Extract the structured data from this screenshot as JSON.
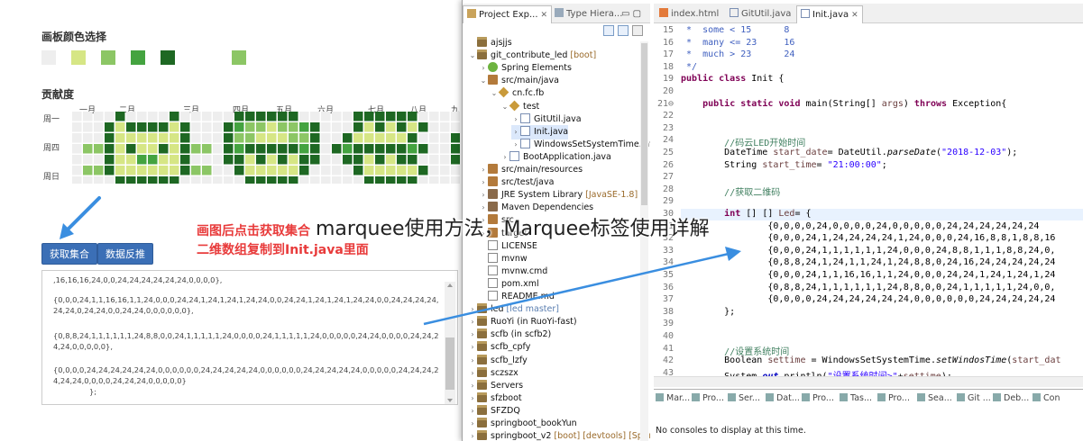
{
  "web": {
    "palette_title": "画板颜色选择",
    "contrib_title": "贡献度",
    "palette_colors": [
      "#eeeeee",
      "#d6e685",
      "#8cc665",
      "#44a340",
      "#1e6823",
      "#8cc665"
    ],
    "heat_colors": {
      "0": "#eeeeee",
      "1": "#d6e685",
      "8": "#8cc665",
      "16": "#44a340",
      "24": "#1e6823"
    },
    "months": [
      "一月",
      "二月",
      "三月",
      "四月",
      "五月",
      "六月",
      "七月",
      "八月",
      "九"
    ],
    "weekdays": [
      "周一",
      "周四",
      "周日"
    ],
    "buttons": {
      "fetch": "获取集合",
      "reverse": "数据反推"
    },
    "annotation_line1": "画图后点击获取集合",
    "annotation_line2": "二维数组复制到Init.java里面",
    "textarea_lines": [
      ",16,16,16,24,0,0,24,24,24,24,24,24,0,0,0,0},",
      "{0,0,0,24,1,1,16,16,1,1,24,0,0,0,24,24,1,24,1,24,1,24,24,0,0,24,24,1,24,1,24,1,24,24,0,0,24,24,24,24,24,24,0,24,24,0,0,24,24,0,0,0,0,0,0},",
      "{0,8,8,24,1,1,1,1,1,1,24,8,8,0,0,24,1,1,1,1,1,24,0,0,0,0,24,1,1,1,1,1,24,0,0,0,0,0,24,24,0,0,0,0,24,24,24,24,0,0,0,0,0},",
      "{0,0,0,0,24,24,24,24,24,24,0,0,0,0,0,0,24,24,24,24,24,0,0,0,0,0,0,24,24,24,24,24,0,0,0,0,0,24,24,24,24,24,24,0,0,0,0,24,24,24,0,0,0,0,0}",
      "};"
    ]
  },
  "eclipse": {
    "tree_tabs": {
      "explorer": "Project Exp...",
      "hierarchy": "Type Hiera..."
    },
    "editor_tabs": [
      "index.html",
      "GitUtil.java",
      "Init.java"
    ],
    "tree": [
      {
        "label": "ajsjjs",
        "depth": 0,
        "icon": "proj",
        "tw": ""
      },
      {
        "label": "git_contribute_led",
        "ann": "[boot]",
        "depth": 0,
        "icon": "proj",
        "tw": "v"
      },
      {
        "label": "Spring Elements",
        "depth": 1,
        "icon": "spring",
        "tw": ">"
      },
      {
        "label": "src/main/java",
        "depth": 1,
        "icon": "src",
        "tw": "v"
      },
      {
        "label": "cn.fc.fb",
        "depth": 2,
        "icon": "pkg",
        "tw": "v"
      },
      {
        "label": "test",
        "depth": 3,
        "icon": "pkg",
        "tw": "v"
      },
      {
        "label": "GitUtil.java",
        "depth": 4,
        "icon": "java",
        "tw": ">"
      },
      {
        "label": "Init.java",
        "depth": 4,
        "icon": "java",
        "tw": ">",
        "selected": true
      },
      {
        "label": "WindowsSetSystemTime.java",
        "depth": 4,
        "icon": "java",
        "tw": ">"
      },
      {
        "label": "BootApplication.java",
        "depth": 3,
        "icon": "java",
        "tw": ">"
      },
      {
        "label": "src/main/resources",
        "depth": 1,
        "icon": "src",
        "tw": ">"
      },
      {
        "label": "src/test/java",
        "depth": 1,
        "icon": "src",
        "tw": ">"
      },
      {
        "label": "JRE System Library",
        "ann": "[JavaSE-1.8]",
        "depth": 1,
        "icon": "lib",
        "tw": ">"
      },
      {
        "label": "Maven Dependencies",
        "depth": 1,
        "icon": "lib",
        "tw": ">"
      },
      {
        "label": "src",
        "depth": 1,
        "icon": "src",
        "tw": ">"
      },
      {
        "label": "target",
        "depth": 1,
        "icon": "src",
        "tw": ">"
      },
      {
        "label": "LICENSE",
        "depth": 1,
        "icon": "file",
        "tw": ""
      },
      {
        "label": "mvnw",
        "depth": 1,
        "icon": "file",
        "tw": ""
      },
      {
        "label": "mvnw.cmd",
        "depth": 1,
        "icon": "file",
        "tw": ""
      },
      {
        "label": "pom.xml",
        "depth": 1,
        "icon": "file",
        "tw": ""
      },
      {
        "label": "README.md",
        "depth": 1,
        "icon": "file",
        "tw": ""
      },
      {
        "label": "led",
        "ann": "[led master]",
        "depth": 0,
        "icon": "proj",
        "tw": ">",
        "annBlue": true
      },
      {
        "label": "RuoYi (in RuoYi-fast)",
        "depth": 0,
        "icon": "proj",
        "tw": ">"
      },
      {
        "label": "scfb (in scfb2)",
        "depth": 0,
        "icon": "proj",
        "tw": ">"
      },
      {
        "label": "scfb_cpfy",
        "depth": 0,
        "icon": "proj",
        "tw": ">"
      },
      {
        "label": "scfb_lzfy",
        "depth": 0,
        "icon": "proj",
        "tw": ">"
      },
      {
        "label": "sczszx",
        "depth": 0,
        "icon": "proj",
        "tw": ">"
      },
      {
        "label": "Servers",
        "depth": 0,
        "icon": "proj",
        "tw": ">"
      },
      {
        "label": "sfzboot",
        "depth": 0,
        "icon": "proj",
        "tw": ">"
      },
      {
        "label": "SFZDQ",
        "depth": 0,
        "icon": "proj",
        "tw": ">"
      },
      {
        "label": "springboot_bookYun",
        "depth": 0,
        "icon": "proj",
        "tw": ">"
      },
      {
        "label": "springboot_v2",
        "ann": "[boot] [devtools] [Spring...",
        "depth": 0,
        "icon": "proj",
        "tw": ">"
      }
    ],
    "code": [
      {
        "n": "15",
        "html": "<span class='jd'> *  some &lt; 15      8</span>"
      },
      {
        "n": "16",
        "html": "<span class='jd'> *  many &lt;= 23     16</span>"
      },
      {
        "n": "17",
        "html": "<span class='jd'> *  much &gt; 23      24</span>"
      },
      {
        "n": "18",
        "html": "<span class='jd'> */</span>"
      },
      {
        "n": "19",
        "html": "<span class='kw'>public class</span> Init {"
      },
      {
        "n": "20",
        "html": ""
      },
      {
        "n": "21⊖",
        "html": "    <span class='kw'>public static void</span> main(String[] <span class='var'>args</span>) <span class='kw'>throws</span> Exception{"
      },
      {
        "n": "22",
        "html": ""
      },
      {
        "n": "23",
        "html": ""
      },
      {
        "n": "24",
        "html": "        <span class='cm'>//码云LED开始时间</span>"
      },
      {
        "n": "25",
        "html": "        DateTime <span class='var'>start_date</span>= DateUtil.<span class='it'>parseDate</span>(<span class='str'>\"2018-12-03\"</span>);"
      },
      {
        "n": "26",
        "html": "        String <span class='var'>start_time</span>= <span class='str'>\"21:00:00\"</span>;"
      },
      {
        "n": "27",
        "html": ""
      },
      {
        "n": "28",
        "html": "        <span class='cm'>//获取二维码</span>"
      },
      {
        "n": "29",
        "html": ""
      },
      {
        "n": "30",
        "html": "        <span class='kw'>int</span> [] [] <span class='var'>Led</span>= {"
      },
      {
        "n": "31",
        "html": "                {0,0,0,0,24,0,0,0,0,24,0,0,0,0,0,24,24,24,24,24,24"
      },
      {
        "n": "32",
        "html": "                {0,0,0,24,1,24,24,24,24,1,24,0,0,0,24,16,8,8,1,8,8,16"
      },
      {
        "n": "33",
        "html": "                {0,0,0,24,1,1,1,1,1,1,24,0,0,0,24,8,8,1,1,1,8,8,24,0,"
      },
      {
        "n": "34",
        "html": "                {0,8,8,24,1,24,1,1,24,1,24,8,8,0,24,16,24,24,24,24,24"
      },
      {
        "n": "35",
        "html": "                {0,0,0,24,1,1,16,16,1,1,24,0,0,0,24,24,1,24,1,24,1,24"
      },
      {
        "n": "36",
        "html": "                {0,8,8,24,1,1,1,1,1,1,24,8,8,0,0,24,1,1,1,1,1,24,0,0,"
      },
      {
        "n": "37",
        "html": "                {0,0,0,0,24,24,24,24,24,24,0,0,0,0,0,0,24,24,24,24,24"
      },
      {
        "n": "38",
        "html": "        };"
      },
      {
        "n": "39",
        "html": ""
      },
      {
        "n": "40",
        "html": ""
      },
      {
        "n": "41",
        "html": "        <span class='cm'>//设置系统时间</span>"
      },
      {
        "n": "42",
        "html": "        Boolean <span class='var'>settime</span> = WindowsSetSystemTime.<span class='it'>setWindosTime</span>(<span class='var'>start_dat</span>"
      },
      {
        "n": "43",
        "html": "        System.<span class='fld'>out</span>.println(<span class='str'>\"设置系统时间&gt;\"</span>+<span class='var'>settime</span>);"
      },
      {
        "n": "44",
        "html": ""
      }
    ],
    "console_tabs": [
      "Mar...",
      "Pro...",
      "Ser...",
      "Dat...",
      "Pro...",
      "Tas...",
      "Pro...",
      "Sea...",
      "Git ...",
      "Deb...",
      "Con"
    ],
    "console_message": "No consoles to display at this time."
  },
  "watermark": "marquee使用方法，Marquee标签使用详解"
}
